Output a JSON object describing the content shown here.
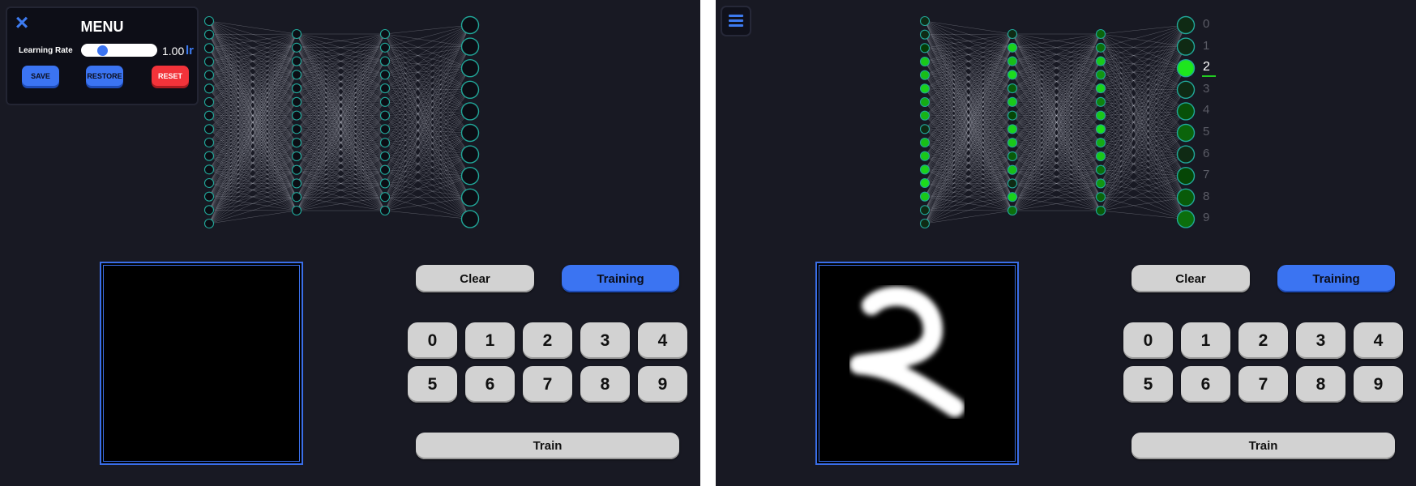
{
  "menu": {
    "title": "MENU",
    "close_icon": "×",
    "learning_rate_label": "Learning Rate",
    "learning_rate_value": "1.00",
    "learning_rate_unit": "lr",
    "learning_rate_fraction": 0.24,
    "save_label": "SAVE",
    "restore_label": "RESTORE",
    "reset_label": "RESET"
  },
  "controls": {
    "clear_label": "Clear",
    "training_label": "Training",
    "train_label": "Train",
    "digit_buttons": [
      "0",
      "1",
      "2",
      "3",
      "4",
      "5",
      "6",
      "7",
      "8",
      "9"
    ]
  },
  "network": {
    "layer_sizes": [
      16,
      14,
      14,
      10
    ],
    "output_labels": [
      "0",
      "1",
      "2",
      "3",
      "4",
      "5",
      "6",
      "7",
      "8",
      "9"
    ],
    "predicted_digit": "2",
    "right_activations": {
      "layer0": [
        0.1,
        0.05,
        0.15,
        0.85,
        0.8,
        0.9,
        0.7,
        0.75,
        0.1,
        0.8,
        0.85,
        0.9,
        0.95,
        0.85,
        0.1,
        0.05
      ],
      "layer1": [
        0.1,
        0.9,
        0.8,
        0.95,
        0.3,
        0.85,
        0.2,
        0.9,
        0.85,
        0.3,
        0.8,
        0.1,
        0.9,
        0.4
      ],
      "layer2": [
        0.35,
        0.4,
        0.85,
        0.6,
        0.9,
        0.5,
        0.85,
        0.95,
        0.7,
        0.85,
        0.4,
        0.6,
        0.35,
        0.3
      ],
      "output": [
        0.05,
        0.1,
        1.0,
        0.12,
        0.25,
        0.35,
        0.1,
        0.2,
        0.3,
        0.4
      ]
    }
  },
  "colors": {
    "background": "#181923",
    "accent": "#3b74f2",
    "danger": "#f2333a",
    "neuron_border": "#21a89a",
    "active_neuron": "#22dd22",
    "digit_stroke": "#ffffff"
  },
  "icons": {
    "close": "close-icon",
    "menu": "hamburger-icon"
  }
}
